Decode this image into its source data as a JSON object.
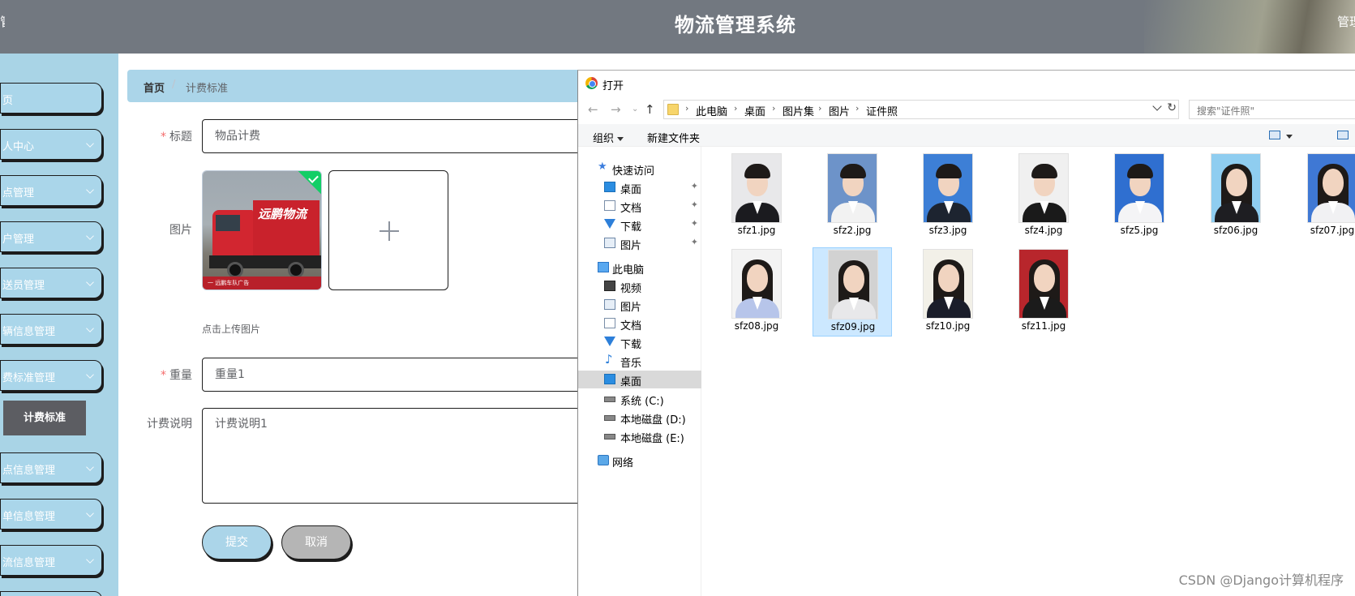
{
  "header": {
    "title": "物流管理系统",
    "right_text": "管理"
  },
  "sidebar": {
    "items": [
      {
        "label": "首页",
        "expandable": false
      },
      {
        "label": "个人中心",
        "expandable": true
      },
      {
        "label": "网点管理",
        "expandable": true
      },
      {
        "label": "用户管理",
        "expandable": true
      },
      {
        "label": "配送员管理",
        "expandable": true
      },
      {
        "label": "车辆信息管理",
        "expandable": true
      },
      {
        "label": "计费标准管理",
        "expandable": true
      },
      {
        "label": "网点信息管理",
        "expandable": true
      },
      {
        "label": "订单信息管理",
        "expandable": true
      },
      {
        "label": "物流信息管理",
        "expandable": true
      }
    ],
    "visible_labels": [
      "页",
      "人中心",
      "点管理",
      "户管理",
      "送员管理",
      "辆信息管理",
      "费标准管理",
      "点信息管理",
      "单信息管理",
      "流信息管理"
    ],
    "active_submenu": "计费标准"
  },
  "breadcrumb": {
    "home": "首页",
    "separator": "/",
    "current": "计费标准"
  },
  "form": {
    "title_label": "标题",
    "title_value": "物品计费",
    "image_label": "图片",
    "image_alt": "远鹏物流",
    "image_banner": "一 远鹏车队广告",
    "upload_tip": "点击上传图片",
    "weight_label": "重量",
    "weight_value": "重量1",
    "desc_label": "计费说明",
    "desc_value": "计费说明1",
    "required_mark": "*",
    "submit_label": "提交",
    "cancel_label": "取消"
  },
  "dialog": {
    "title": "打开",
    "address": [
      "此电脑",
      "桌面",
      "图片集",
      "图片",
      "证件照"
    ],
    "search_placeholder": "搜索\"证件照\"",
    "toolbar": {
      "organize": "组织",
      "new_folder": "新建文件夹"
    },
    "nav": [
      {
        "label": "快速访问",
        "icon": "star-icon",
        "pinned": false,
        "indent": 1
      },
      {
        "label": "桌面",
        "icon": "desktop-icon",
        "pinned": true,
        "indent": 2
      },
      {
        "label": "文档",
        "icon": "document-icon",
        "pinned": true,
        "indent": 2
      },
      {
        "label": "下载",
        "icon": "download-icon",
        "pinned": true,
        "indent": 2
      },
      {
        "label": "图片",
        "icon": "pictures-icon",
        "pinned": true,
        "indent": 2
      },
      {
        "label": "此电脑",
        "icon": "computer-icon",
        "pinned": false,
        "indent": 1
      },
      {
        "label": "视频",
        "icon": "video-icon",
        "pinned": false,
        "indent": 2
      },
      {
        "label": "图片",
        "icon": "pictures-icon",
        "pinned": false,
        "indent": 2
      },
      {
        "label": "文档",
        "icon": "document-icon",
        "pinned": false,
        "indent": 2
      },
      {
        "label": "下载",
        "icon": "download-icon",
        "pinned": false,
        "indent": 2
      },
      {
        "label": "音乐",
        "icon": "music-icon",
        "pinned": false,
        "indent": 2
      },
      {
        "label": "桌面",
        "icon": "desktop-icon",
        "pinned": false,
        "indent": 2,
        "selected": true
      },
      {
        "label": "系统 (C:)",
        "icon": "drive-icon",
        "pinned": false,
        "indent": 2
      },
      {
        "label": "本地磁盘 (D:)",
        "icon": "drive-icon",
        "pinned": false,
        "indent": 2
      },
      {
        "label": "本地磁盘 (E:)",
        "icon": "drive-icon",
        "pinned": false,
        "indent": 2
      },
      {
        "label": "网络",
        "icon": "network-icon",
        "pinned": false,
        "indent": 1
      }
    ],
    "files": [
      {
        "name": "sfz1.jpg",
        "bg": "#e8e8ea",
        "hair": "short",
        "outfit": "#1b1b1f"
      },
      {
        "name": "sfz2.jpg",
        "bg": "#6d93c9",
        "hair": "short",
        "outfit": "#f2f2f2"
      },
      {
        "name": "sfz3.jpg",
        "bg": "#3d7fd6",
        "hair": "short",
        "outfit": "#1d2430"
      },
      {
        "name": "sfz4.jpg",
        "bg": "#f0f0f0",
        "hair": "short",
        "outfit": "#1a1a1a"
      },
      {
        "name": "sfz5.jpg",
        "bg": "#2f6fd0",
        "hair": "short",
        "outfit": "#f4f4f6"
      },
      {
        "name": "sfz06.jpg",
        "bg": "#8fcdf0",
        "hair": "long",
        "outfit": "#1e1e22"
      },
      {
        "name": "sfz07.jpg",
        "bg": "#3f78d4",
        "hair": "long",
        "outfit": "#f1f1f3"
      },
      {
        "name": "sfz08.jpg",
        "bg": "#f3f3f3",
        "hair": "long",
        "outfit": "#b7c5ea"
      },
      {
        "name": "sfz09.jpg",
        "bg": "#d2d2d2",
        "hair": "long",
        "outfit": "#e8e8ea",
        "selected": true
      },
      {
        "name": "sfz10.jpg",
        "bg": "#f2f0e8",
        "hair": "long",
        "outfit": "#1a1d2a"
      },
      {
        "name": "sfz11.jpg",
        "bg": "#b8262c",
        "hair": "long",
        "outfit": "#1b1b1b"
      }
    ]
  },
  "watermark": "CSDN @Django计算机程序",
  "colors": {
    "header_bg": "#727880",
    "sidebar_bg": "#a9d4e6",
    "accent": "#abd5e9",
    "active_submenu_bg": "#5c5d62",
    "required": "#f56c6c",
    "success": "#13ce66",
    "selection": "#cce8ff"
  }
}
